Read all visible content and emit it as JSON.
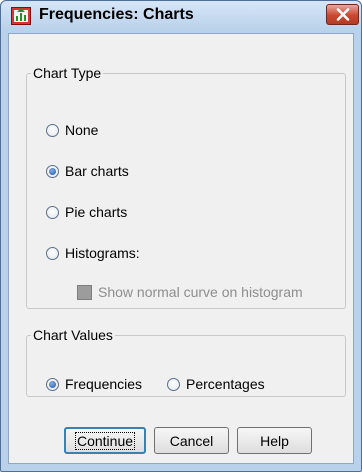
{
  "window": {
    "title": "Frequencies: Charts"
  },
  "chart_type_group": {
    "legend": "Chart Type",
    "options": [
      {
        "label": "None",
        "selected": false
      },
      {
        "label": "Bar charts",
        "selected": true
      },
      {
        "label": "Pie charts",
        "selected": false
      },
      {
        "label": "Histograms:",
        "selected": false
      }
    ],
    "normal_curve": {
      "label": "Show normal curve on histogram",
      "checked": false,
      "enabled": false
    }
  },
  "chart_values_group": {
    "legend": "Chart Values",
    "options": [
      {
        "label": "Frequencies",
        "selected": true
      },
      {
        "label": "Percentages",
        "selected": false
      }
    ]
  },
  "buttons": {
    "continue": "Continue",
    "cancel": "Cancel",
    "help": "Help"
  },
  "colors": {
    "frame": "#b9d1ea",
    "close": "#c8482f",
    "client": "#f0f0f0",
    "default_button_border": "#3c7fb1"
  }
}
